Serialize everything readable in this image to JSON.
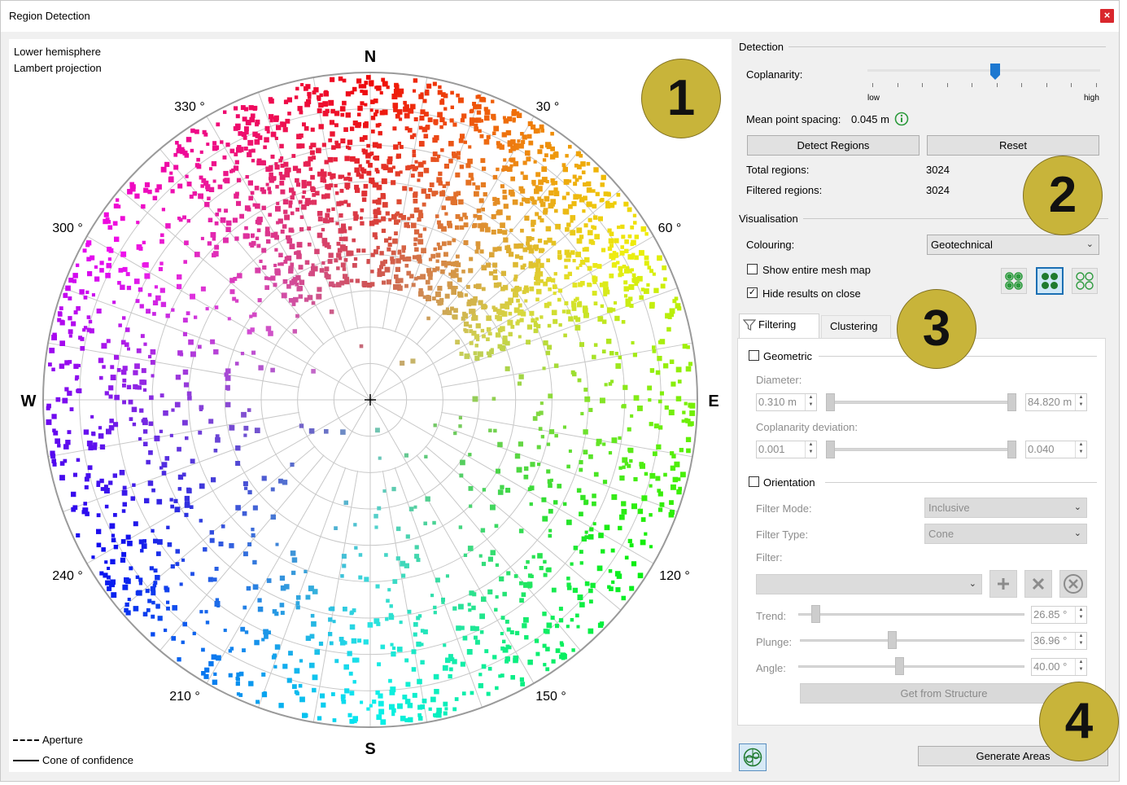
{
  "window": {
    "title": "Region Detection",
    "close_glyph": "×"
  },
  "plot": {
    "projection_lines": [
      "Lower hemisphere",
      "Lambert projection"
    ],
    "cardinals": {
      "n": "N",
      "e": "E",
      "s": "S",
      "w": "W"
    },
    "azimuth_labels": [
      "30 °",
      "60 °",
      "120 °",
      "150 °",
      "210 °",
      "240 °",
      "300 °",
      "330 °"
    ],
    "legend": {
      "aperture": "Aperture",
      "cone": "Cone of confidence"
    },
    "colours": {
      "grid": "#c8c8c8",
      "outline": "#9a9a9a"
    }
  },
  "detection": {
    "header": "Detection",
    "coplanarity_label": "Coplanarity:",
    "coplanarity_low": "low",
    "coplanarity_high": "high",
    "coplanarity_level": 0.55,
    "mean_spacing_label": "Mean point spacing:",
    "mean_spacing_value": "0.045 m",
    "detect_button": "Detect Regions",
    "reset_button": "Reset",
    "total_label": "Total regions:",
    "total_value": "3024",
    "filtered_label": "Filtered regions:",
    "filtered_value": "3024"
  },
  "visualisation": {
    "header": "Visualisation",
    "colouring_label": "Colouring:",
    "colouring_value": "Geotechnical",
    "show_mesh_label": "Show entire mesh map",
    "show_mesh_checked": false,
    "hide_results_label": "Hide results on close",
    "hide_results_checked": true
  },
  "tabs": {
    "filtering": "Filtering",
    "clustering": "Clustering"
  },
  "filtering": {
    "geometric_label": "Geometric",
    "diameter_label": "Diameter:",
    "diameter_min": "0.310 m",
    "diameter_max": "84.820 m",
    "coplanarity_dev_label": "Coplanarity deviation:",
    "coplanarity_dev_min": "0.001",
    "coplanarity_dev_max": "0.040",
    "orientation_label": "Orientation",
    "filter_mode_label": "Filter Mode:",
    "filter_mode_value": "Inclusive",
    "filter_type_label": "Filter Type:",
    "filter_type_value": "Cone",
    "filter_label": "Filter:",
    "trend_label": "Trend:",
    "trend_value": "26.85 °",
    "plunge_label": "Plunge:",
    "plunge_value": "36.96 °",
    "angle_label": "Angle:",
    "angle_value": "40.00 °",
    "get_from_structure": "Get from Structure"
  },
  "footer": {
    "generate_button": "Generate Areas"
  },
  "callouts": [
    "1",
    "2",
    "3",
    "4"
  ]
}
